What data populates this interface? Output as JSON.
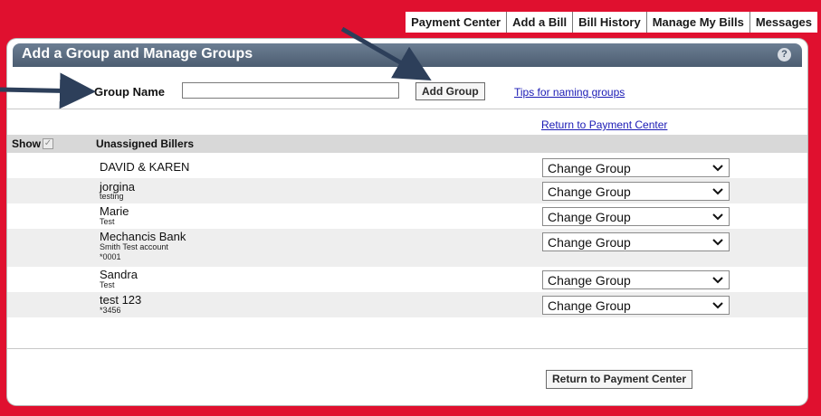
{
  "nav": {
    "tabs": [
      "Payment Center",
      "Add a Bill",
      "Bill History",
      "Manage My Bills",
      "Messages"
    ]
  },
  "panel": {
    "title": "Add a Group and Manage Groups",
    "help_icon": "?"
  },
  "group_form": {
    "label": "Group Name",
    "input_value": "",
    "add_button": "Add Group",
    "tips_link": "Tips for naming groups"
  },
  "return_link": "Return to Payment Center",
  "list": {
    "show_label": "Show",
    "show_checked": true,
    "title": "Unassigned Billers",
    "select_default": "Change Group",
    "billers": [
      {
        "name": "DAVID & KAREN",
        "lines": []
      },
      {
        "name": "jorgina",
        "lines": [
          "testing"
        ]
      },
      {
        "name": "Marie",
        "lines": [
          "Test"
        ]
      },
      {
        "name": "Mechancis Bank",
        "lines": [
          "Smith Test account",
          "*0001"
        ]
      },
      {
        "name": "Sandra",
        "lines": [
          "Test"
        ]
      },
      {
        "name": "test 123",
        "lines": [
          "*3456"
        ]
      }
    ]
  },
  "return_button": "Return to Payment Center",
  "colors": {
    "page_background": "#e0102f",
    "header_bar": "#5a6b7f",
    "link": "#1a1ab5",
    "annotation_arrow": "#2d3f5a"
  }
}
